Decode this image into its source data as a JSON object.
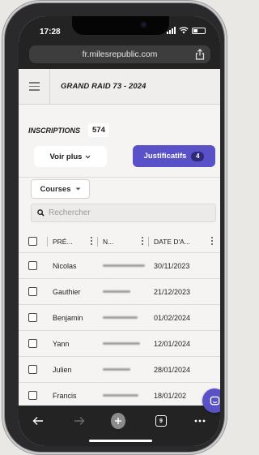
{
  "status": {
    "time": "17:28"
  },
  "browser": {
    "url": "fr.milesrepublic.com",
    "tab_count": "9"
  },
  "header": {
    "event_title": "GRAND RAID 73 - 2024"
  },
  "inscriptions": {
    "label": "INSCRIPTIONS",
    "count": "574",
    "voir_plus_label": "Voir plus",
    "justificatifs_label": "Justificatifs",
    "justificatifs_badge": "4"
  },
  "filters": {
    "courses_label": "Courses",
    "search_placeholder": "Rechercher"
  },
  "table": {
    "columns": [
      "PRÉ...",
      "N...",
      "DATE D'A..."
    ],
    "rows": [
      {
        "prenom": "Nicolas",
        "date": "30/11/2023"
      },
      {
        "prenom": "Gauthier",
        "date": "21/12/2023"
      },
      {
        "prenom": "Benjamin",
        "date": "01/02/2024"
      },
      {
        "prenom": "Yann",
        "date": "12/01/2024"
      },
      {
        "prenom": "Julien",
        "date": "28/01/2024"
      },
      {
        "prenom": "Francis",
        "date": "18/01/202"
      }
    ]
  },
  "icons": {
    "share": "share-icon",
    "menu": "hamburger-icon",
    "search": "search-icon",
    "chat": "chat-icon",
    "back": "back-arrow-icon",
    "forward": "forward-arrow-icon",
    "new_tab": "plus-icon",
    "tabs": "tabs-icon",
    "more": "more-icon"
  },
  "colors": {
    "accent": "#5851c7",
    "chrome": "#232323",
    "page_bg": "#f5f4f2"
  }
}
